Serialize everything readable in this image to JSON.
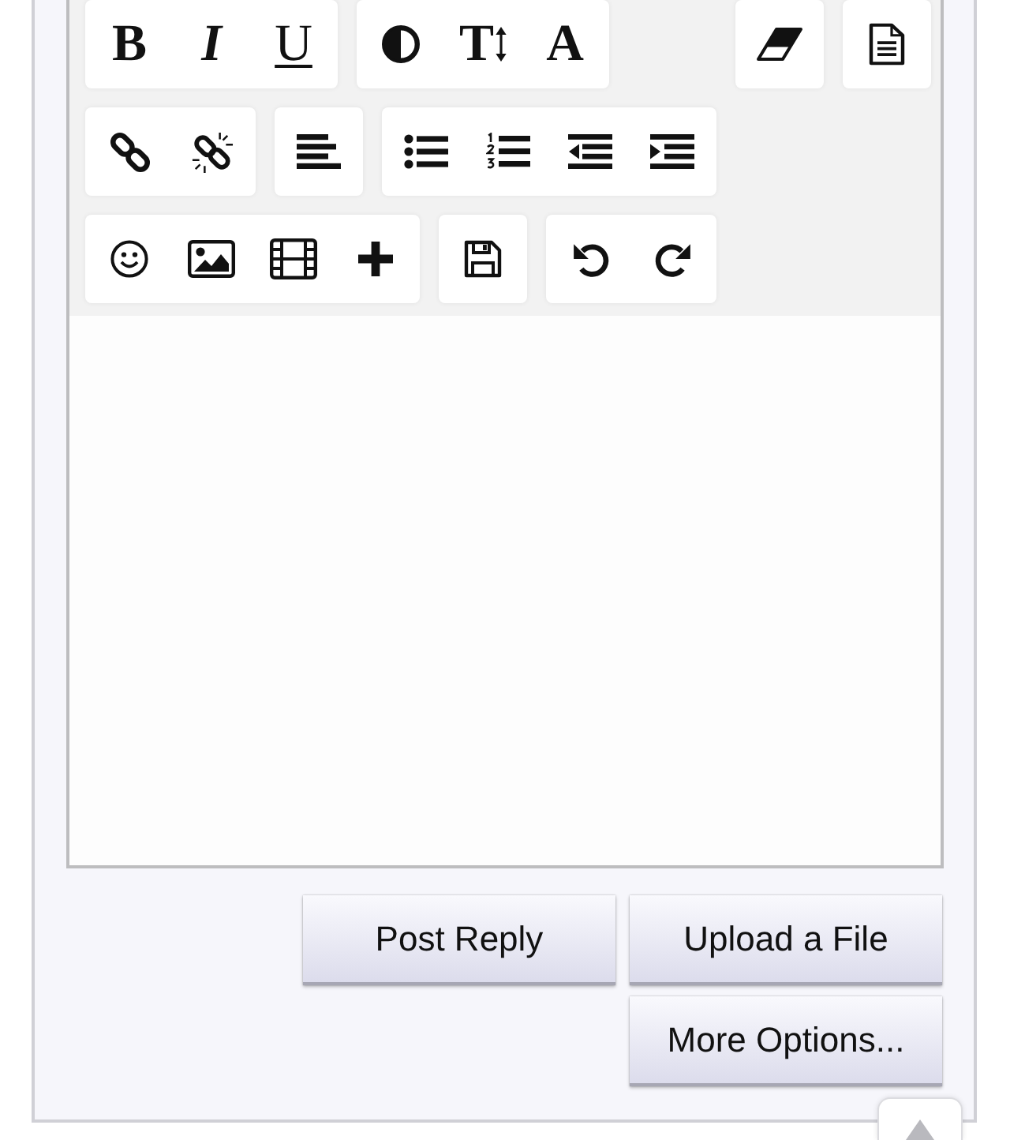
{
  "toolbar": {
    "rows": [
      {
        "start": [
          {
            "buttons": [
              {
                "kind": "bold",
                "label": "B"
              },
              {
                "kind": "italic",
                "label": "I"
              },
              {
                "kind": "underline",
                "label": "U"
              }
            ]
          },
          {
            "buttons": [
              {
                "kind": "contrast"
              },
              {
                "kind": "text-height",
                "label": "T"
              },
              {
                "kind": "font",
                "label": "A"
              }
            ]
          }
        ],
        "end": [
          {
            "buttons": [
              {
                "kind": "eraser"
              }
            ]
          },
          {
            "buttons": [
              {
                "kind": "document"
              }
            ]
          }
        ]
      },
      {
        "start": [
          {
            "buttons": [
              {
                "kind": "link"
              },
              {
                "kind": "unlink"
              }
            ]
          },
          {
            "buttons": [
              {
                "kind": "align-left"
              }
            ]
          },
          {
            "buttons": [
              {
                "kind": "bullet-list"
              },
              {
                "kind": "numbered-list"
              },
              {
                "kind": "outdent"
              },
              {
                "kind": "indent"
              }
            ]
          }
        ]
      },
      {
        "start": [
          {
            "buttons": [
              {
                "kind": "emoji"
              },
              {
                "kind": "image"
              },
              {
                "kind": "video"
              },
              {
                "kind": "plus"
              }
            ]
          },
          {
            "buttons": [
              {
                "kind": "save"
              }
            ]
          },
          {
            "buttons": [
              {
                "kind": "undo"
              },
              {
                "kind": "redo"
              }
            ]
          }
        ]
      }
    ]
  },
  "actions": {
    "rows": [
      [
        "Post Reply",
        "Upload a File"
      ],
      [
        "",
        "More Options..."
      ]
    ]
  }
}
